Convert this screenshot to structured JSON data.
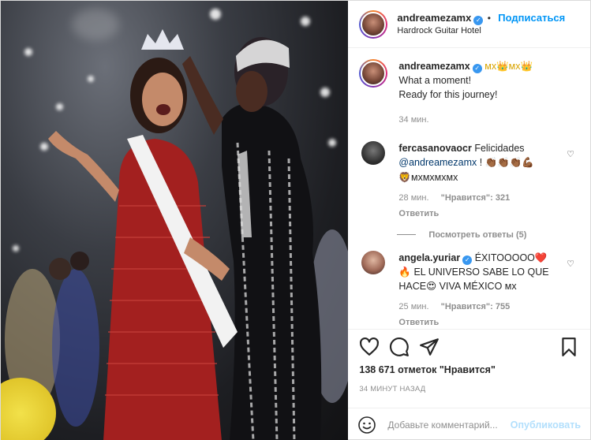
{
  "header": {
    "username": "andreamezamx",
    "follow_label": "Подписаться",
    "location": "Hardrock Guitar Hotel"
  },
  "caption": {
    "username": "andreamezamx",
    "suffix": "мх👑мх👑",
    "line1": "What a moment!",
    "line2": "Ready for this journey!",
    "time": "34 мин."
  },
  "comments": [
    {
      "username": "fercasanovaocr",
      "text1": "Felicidades",
      "mention": "@andreamezamx",
      "text2": "! 👏🏾👏🏾👏🏾💪🏾",
      "text3": "🦁мхмхмхмх",
      "time": "28 мин.",
      "likes": "\"Нравится\": 321",
      "reply": "Ответить"
    },
    {
      "username": "angela.yuriar",
      "text1": "ÉXITOOOOO❤️",
      "text2": "🔥 EL UNIVERSO SABE LO QUE",
      "text3": "HACE😍 VIVA MÉXICO мх",
      "time": "25 мин.",
      "likes": "\"Нравится\": 755",
      "reply": "Ответить"
    }
  ],
  "view_replies": "Посмотреть ответы (5)",
  "likes_count": "138 671 отметок \"Нравится\"",
  "post_time": "34 МИНУТ НАЗАД",
  "add_comment": {
    "placeholder": "Добавьте комментарий...",
    "post_label": "Опубликовать"
  },
  "colors": {
    "accent": "#0095f6",
    "verified": "#3897f0",
    "muted": "#8e8e8e",
    "post_disabled": "#b2dffc"
  }
}
